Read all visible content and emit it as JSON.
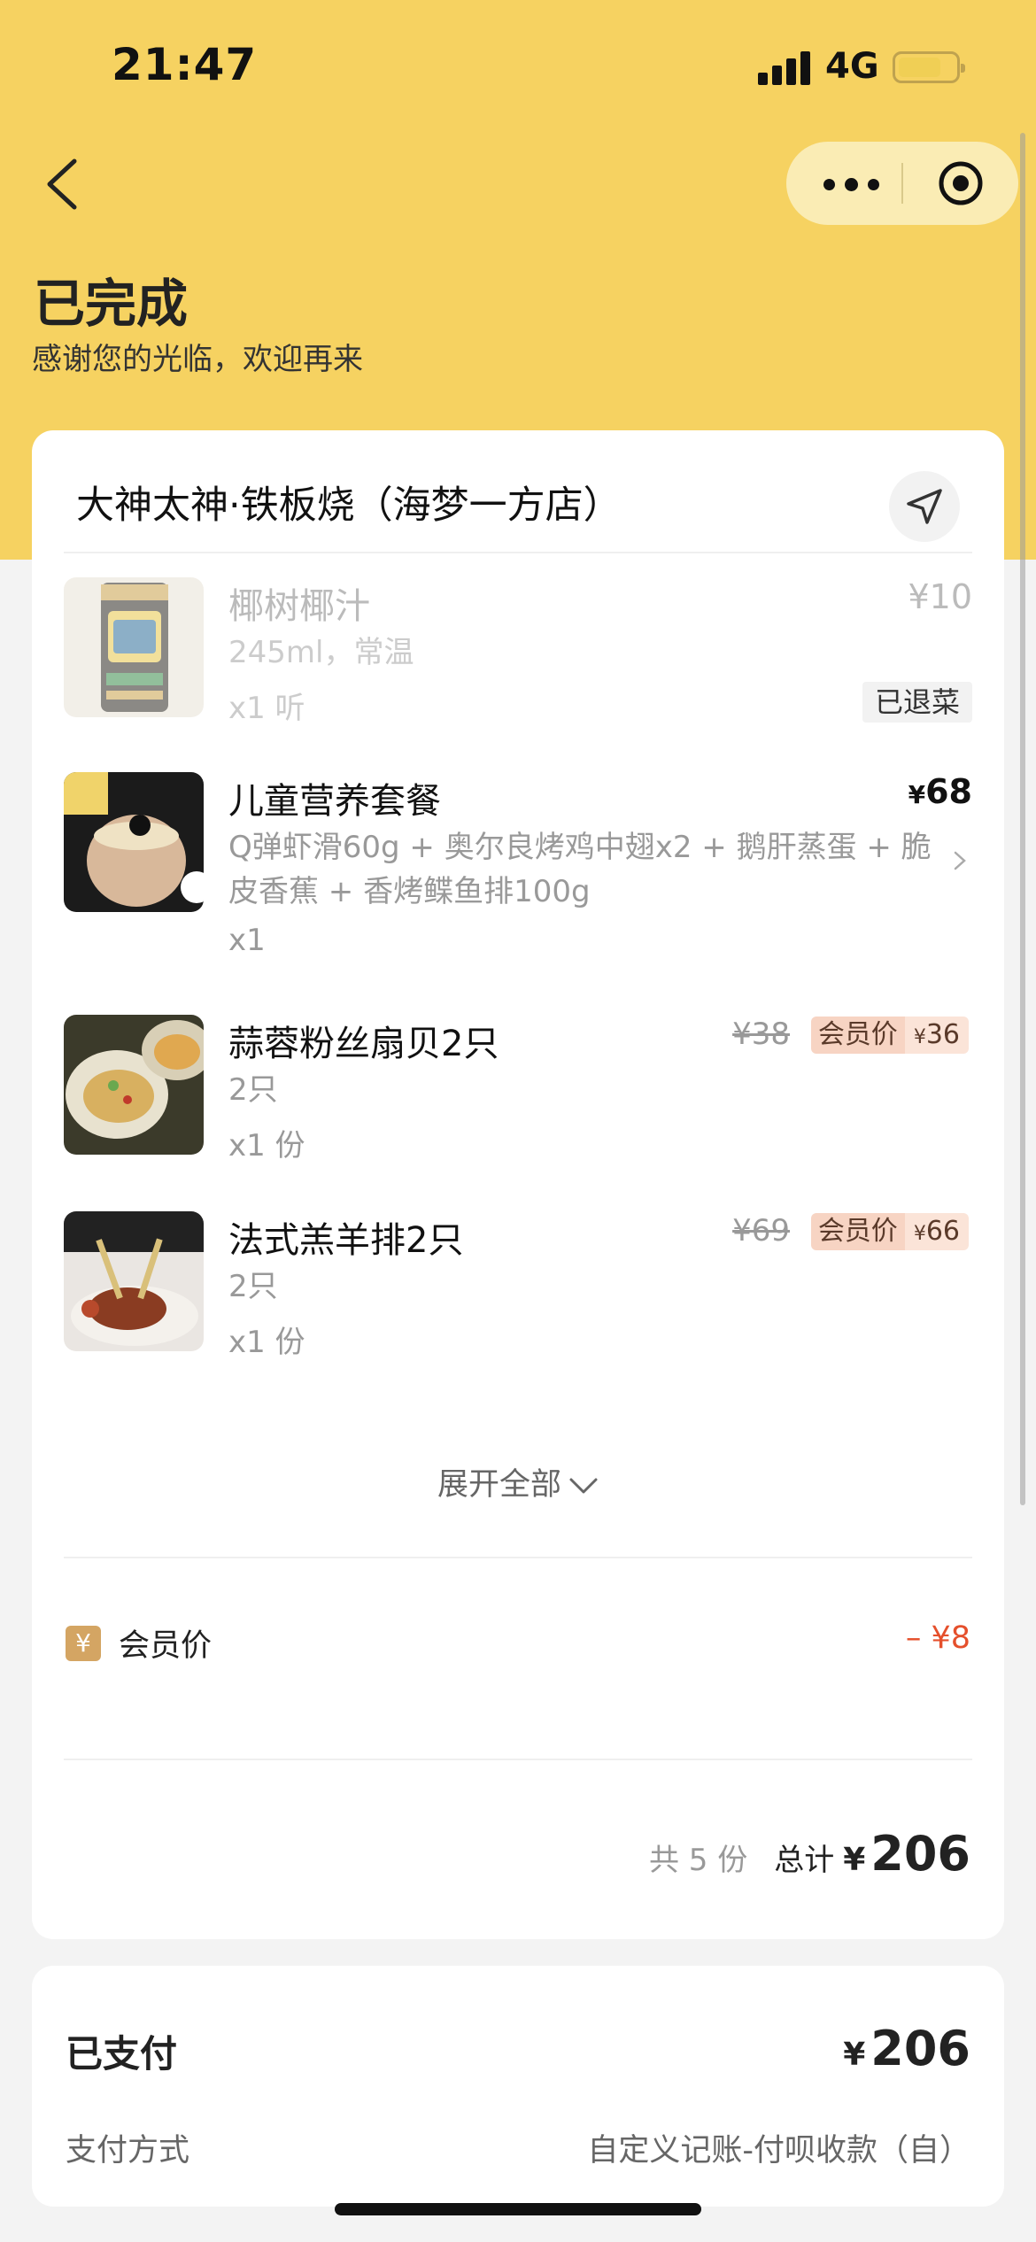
{
  "status_bar": {
    "time": "21:47",
    "network": "4G",
    "battery_level": 0.75
  },
  "header": {
    "title": "已完成",
    "subtitle": "感谢您的光临，欢迎再来"
  },
  "shop": {
    "name": "大神太神·铁板烧（海梦一方店）"
  },
  "items": [
    {
      "name": "椰树椰汁",
      "spec": "245ml，常温",
      "qty": "x1 听",
      "price": "¥10",
      "tag": "已退菜"
    },
    {
      "name": "儿童营养套餐",
      "spec": "Q弹虾滑60g + 奥尔良烤鸡中翅x2 + 鹅肝蒸蛋 + 脆皮香蕉 + 香烤鲽鱼排100g",
      "qty": "x1",
      "price_yen": "¥",
      "price_value": "68"
    },
    {
      "name": "蒜蓉粉丝扇贝2只",
      "spec": "2只",
      "qty": "x1 份",
      "original_price": "¥38",
      "member_label": "会员价",
      "member_yen": "¥",
      "member_value": "36"
    },
    {
      "name": "法式羔羊排2只",
      "spec": "2只",
      "qty": "x1 份",
      "original_price": "¥69",
      "member_label": "会员价",
      "member_yen": "¥",
      "member_value": "66"
    }
  ],
  "expand_label": "展开全部",
  "discount": {
    "icon": "¥",
    "label": "会员价",
    "amount": "– ¥8"
  },
  "summary": {
    "count": "共 5 份",
    "label": "总计",
    "yen": "¥",
    "total": "206"
  },
  "payment": {
    "paid_label": "已支付",
    "yen": "¥",
    "amount": "206",
    "method_label": "支付方式",
    "method_value": "自定义记账-付呗收款（自）"
  },
  "colors": {
    "header_bg": "#f6d261",
    "accent_red": "#e5502c",
    "member_tag": "#f7d4c3"
  }
}
